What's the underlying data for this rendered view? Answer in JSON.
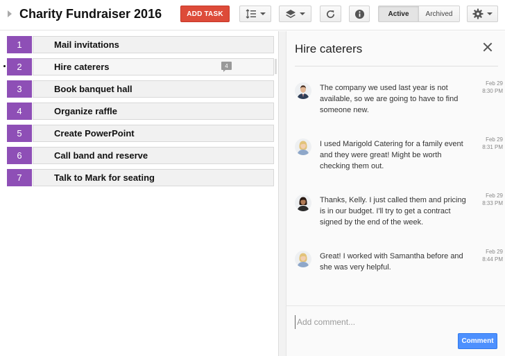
{
  "header": {
    "title": "Charity Fundraiser 2016",
    "add_task_label": "ADD TASK",
    "filter_active": "Active",
    "filter_archived": "Archived",
    "icons": [
      "expand-arrow-icon",
      "sort-icon",
      "layers-icon",
      "refresh-icon",
      "info-icon",
      "gear-icon"
    ]
  },
  "tasks": [
    {
      "number": "1",
      "title": "Mail invitations"
    },
    {
      "number": "2",
      "title": "Hire caterers",
      "comment_count": "4"
    },
    {
      "number": "3",
      "title": "Book banquet hall"
    },
    {
      "number": "4",
      "title": "Organize raffle"
    },
    {
      "number": "5",
      "title": "Create PowerPoint"
    },
    {
      "number": "6",
      "title": "Call band and reserve"
    },
    {
      "number": "7",
      "title": "Talk to Mark for seating"
    }
  ],
  "detail": {
    "title": "Hire caterers",
    "comments": [
      {
        "text": "The company we used last year is not available, so we are going to have to find someone new.",
        "date": "Feb 29",
        "time": "8:30 PM"
      },
      {
        "text": "I used Marigold Catering for a family event and they were great!  Might be worth checking them out.",
        "date": "Feb 29",
        "time": "8:31 PM"
      },
      {
        "text": "Thanks, Kelly.  I just called them and pricing is in our budget. I'll try to get a contract signed by the end of the week.",
        "date": "Feb 29",
        "time": "8:33 PM"
      },
      {
        "text": "Great! I worked with Samantha before and she was very helpful.",
        "date": "Feb 29",
        "time": "8:44 PM"
      }
    ],
    "add_comment_placeholder": "Add comment...",
    "comment_button": "Comment"
  },
  "colors": {
    "task_number_bg": "#8e4fb6",
    "add_task_bg": "#dd4b39",
    "comment_button_bg": "#4d90fe"
  }
}
